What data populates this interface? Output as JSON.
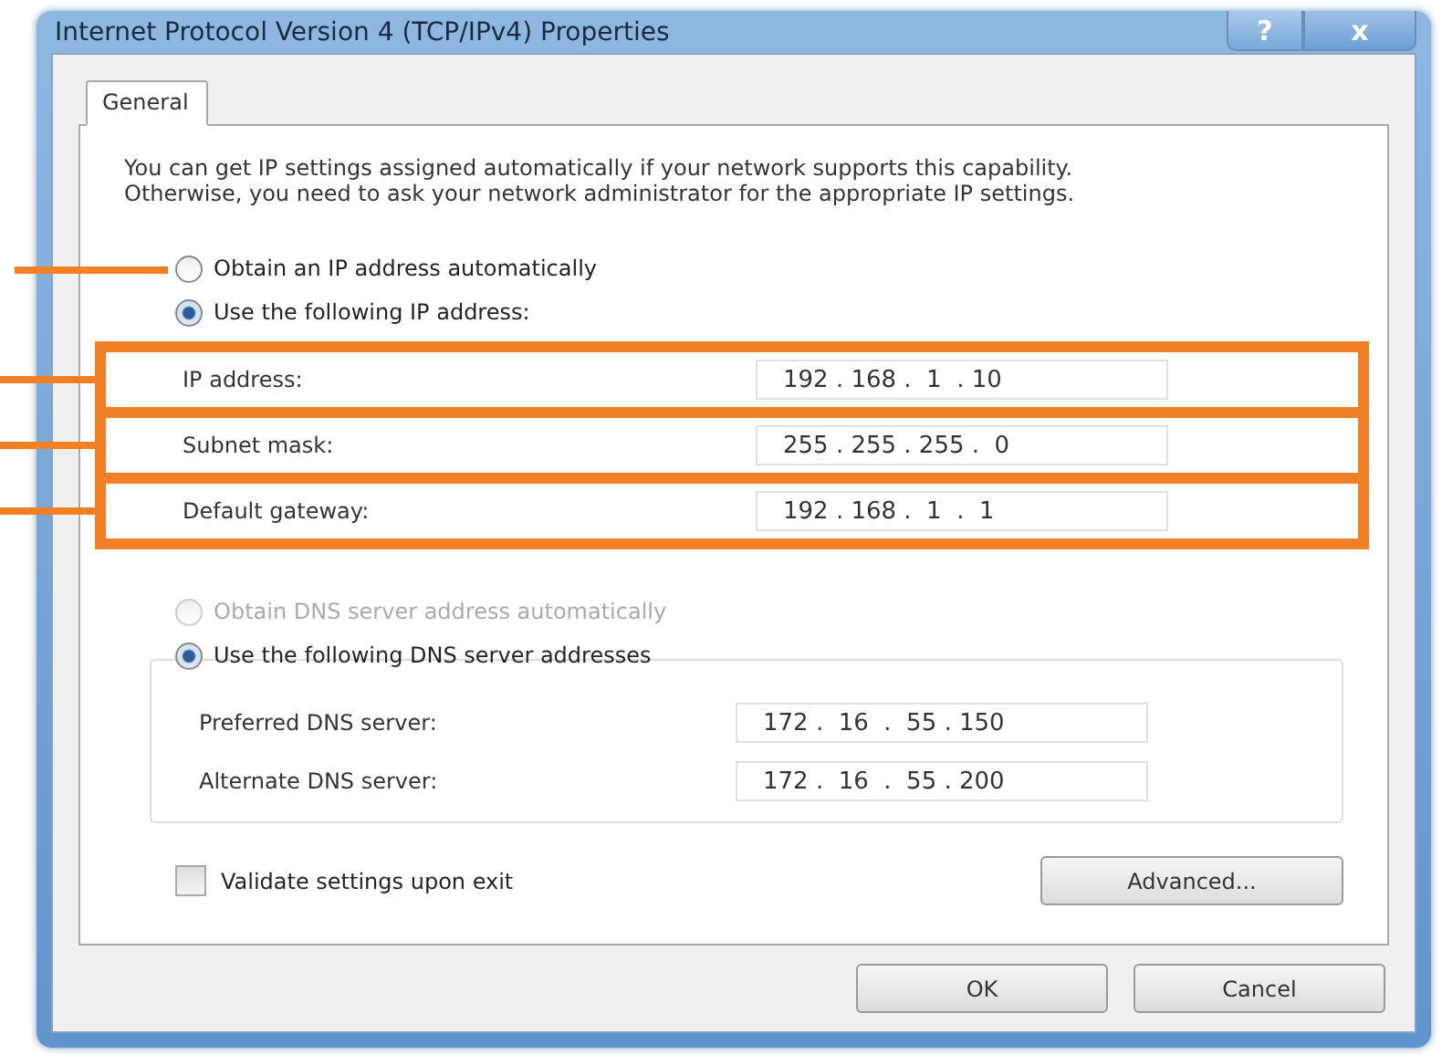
{
  "window": {
    "title": "Internet Protocol Version 4 (TCP/IPv4) Properties",
    "help_button": "?",
    "close_button": "x"
  },
  "tabs": [
    {
      "label": "General",
      "selected": true
    }
  ],
  "intro": "You can get IP settings assigned automatically if your network supports this capability. Otherwise, you need to ask your network administrator for the appropriate IP settings.",
  "ip_options": [
    {
      "label": "Obtain an IP address automatically",
      "selected": false,
      "disabled": false,
      "callout": true
    },
    {
      "label": "Use the following IP address:",
      "selected": true,
      "disabled": false,
      "callout": false
    }
  ],
  "ip_fields": [
    {
      "label": "IP address:",
      "value": "192 . 168 .  1  . 10",
      "highlighted": true
    },
    {
      "label": "Subnet mask:",
      "value": "255 . 255 . 255 .  0",
      "highlighted": true
    },
    {
      "label": "Default gateway:",
      "value": "192 . 168 .  1  .  1",
      "highlighted": true
    }
  ],
  "dns_options": [
    {
      "label": "Obtain DNS server address automatically",
      "selected": false,
      "disabled": true
    },
    {
      "label": "Use the following DNS server addresses",
      "selected": true,
      "disabled": false
    }
  ],
  "dns_fields": [
    {
      "label": "Preferred DNS server:",
      "value": "172 .  16  .  55 . 150"
    },
    {
      "label": "Alternate DNS server:",
      "value": "172 .  16  .  55 . 200"
    }
  ],
  "validate": {
    "label": "Validate settings upon exit",
    "checked": false
  },
  "advanced_button": "Advanced...",
  "buttons": [
    "OK",
    "Cancel"
  ]
}
